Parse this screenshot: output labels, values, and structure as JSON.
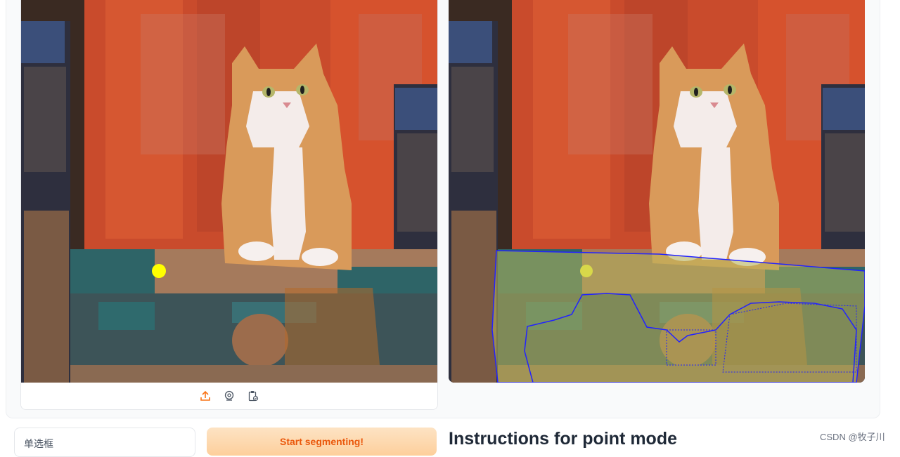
{
  "toolbar": {
    "icons": [
      "upload-icon",
      "webcam-icon",
      "clipboard-icon"
    ],
    "accent": "#f97316"
  },
  "selection_point": {
    "color": "#ffff00"
  },
  "mask": {
    "outline_color": "#2222ff",
    "fill_color": "#b7b75a"
  },
  "controls": {
    "radio_label": "单选框",
    "start_button": "Start segmenting!"
  },
  "instructions": {
    "title": "Instructions for point mode"
  },
  "watermark": "CSDN @牧子川",
  "colors": {
    "button_text": "#ea580c",
    "button_bg": "#fdd6a8"
  }
}
